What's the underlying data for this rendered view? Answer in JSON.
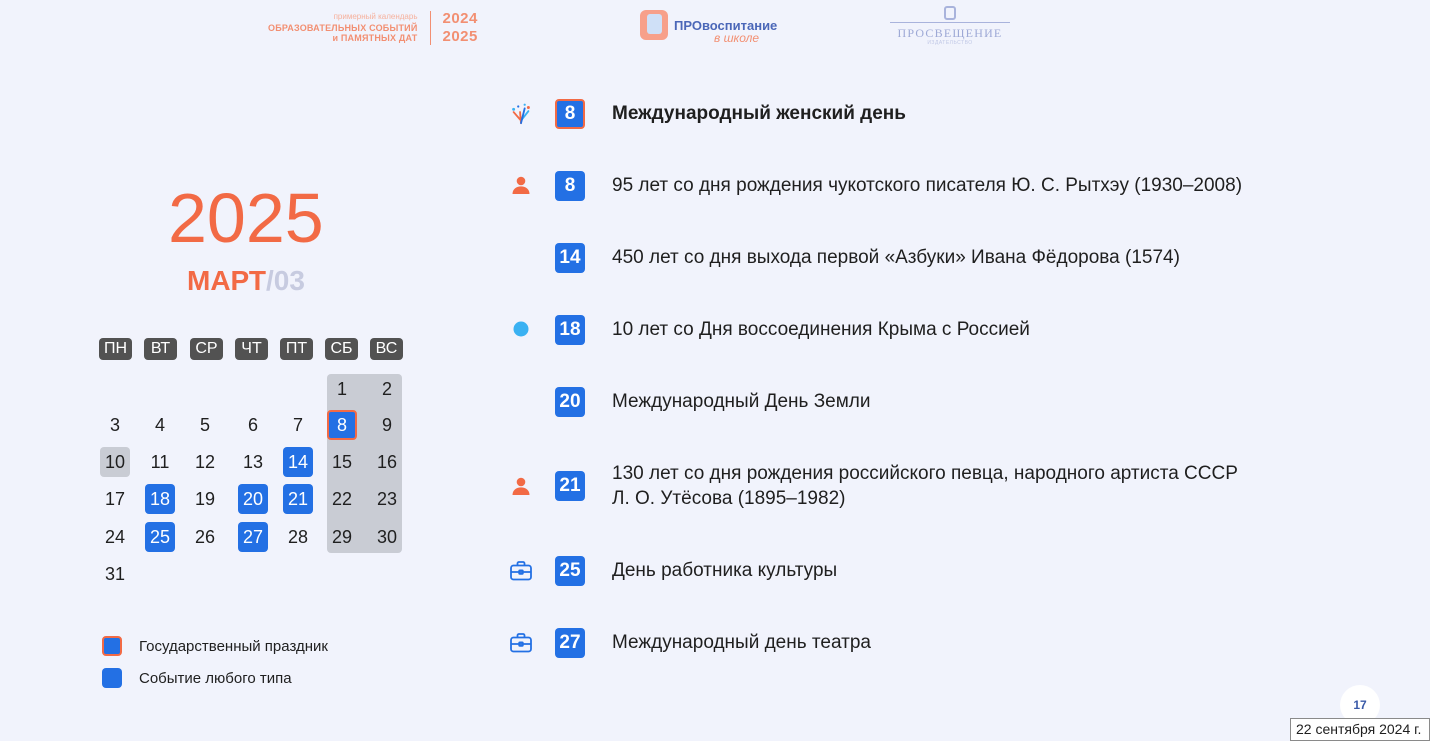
{
  "header": {
    "calendar_logo": {
      "line1": "примерный календарь",
      "line2": "ОБРАЗОВАТЕЛЬНЫХ СОБЫТИЙ",
      "line3": "и ПАМЯТНЫХ ДАТ",
      "year1": "2024",
      "year2": "2025"
    },
    "pro_logo": {
      "main": "ПРОвоспитание",
      "sub": "в школе"
    },
    "pros_logo": {
      "name": "ПРОСВЕЩЕНИЕ",
      "tagline": "ИЗДАТЕЛЬСТВО"
    }
  },
  "year": "2025",
  "month": {
    "name": "МАРТ",
    "number": "/03"
  },
  "calendar": {
    "weekdays": [
      "ПН",
      "ВТ",
      "СР",
      "ЧТ",
      "ПТ",
      "СБ",
      "ВС"
    ],
    "days": [
      "1",
      "2",
      "3",
      "4",
      "5",
      "6",
      "7",
      "8",
      "9",
      "10",
      "11",
      "12",
      "13",
      "14",
      "15",
      "16",
      "17",
      "18",
      "19",
      "20",
      "21",
      "22",
      "23",
      "24",
      "25",
      "26",
      "27",
      "28",
      "29",
      "30",
      "31"
    ],
    "holiday_days": [
      8
    ],
    "event_days": [
      14,
      18,
      20,
      21,
      25,
      27
    ],
    "highlight_days": [
      10
    ]
  },
  "legend": [
    {
      "label": "Государственный праздник"
    },
    {
      "label": "Событие любого типа"
    }
  ],
  "events": [
    {
      "day": "8",
      "icon": "fireworks-icon",
      "text": "Международный женский день",
      "holiday": true
    },
    {
      "day": "8",
      "icon": "person-icon",
      "text": "95 лет со дня рождения чукотского писателя Ю. С. Рытхэу (1930–2008)"
    },
    {
      "day": "14",
      "icon": "",
      "text": "450 лет со дня выхода первой «Азбуки» Ивана Фёдорова (1574)"
    },
    {
      "day": "18",
      "icon": "dot-icon",
      "text": "10 лет со Дня воссоединения Крыма с Россией"
    },
    {
      "day": "20",
      "icon": "",
      "text": "Международный День Земли"
    },
    {
      "day": "21",
      "icon": "person-icon",
      "text_line1": "130 лет со дня рождения российского певца, народного артиста СССР",
      "text_line2": "Л. О. Утёсова (1895–1982)"
    },
    {
      "day": "25",
      "icon": "briefcase-icon",
      "text": "День работника культуры"
    },
    {
      "day": "27",
      "icon": "briefcase-icon",
      "text": "Международный день театра"
    }
  ],
  "colors": {
    "accent": "#f26a45",
    "event_blue": "#2370e4",
    "background": "#f1f3fc",
    "weekday_label": "#525252",
    "weekend_fill": "#c9ccd4"
  },
  "footer": {
    "page_number": "17",
    "date_stamp": "22 сентября 2024 г."
  }
}
